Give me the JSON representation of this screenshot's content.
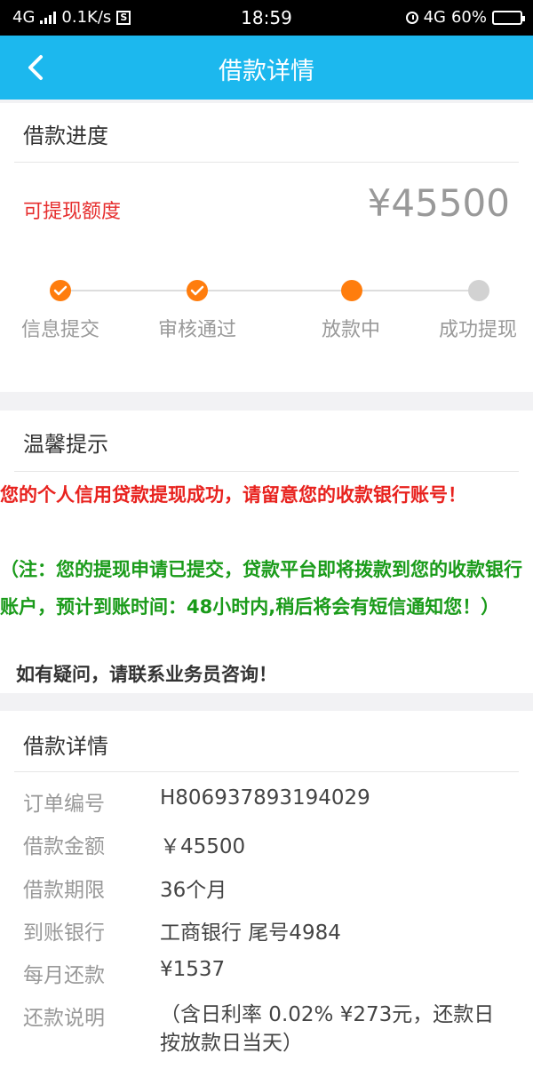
{
  "status_bar": {
    "network": "4G",
    "speed": "0.1K/s",
    "s_badge": "S",
    "time": "18:59",
    "network_right": "4G",
    "battery": "60%"
  },
  "header": {
    "title": "借款详情",
    "back_icon": "chevron-left-icon"
  },
  "progress": {
    "section_title": "借款进度",
    "available_label": "可提现额度",
    "available_amount": "¥45500",
    "steps": [
      {
        "label": "信息提交",
        "state": "done"
      },
      {
        "label": "审核通过",
        "state": "done"
      },
      {
        "label": "放款中",
        "state": "active"
      },
      {
        "label": "成功提现",
        "state": "pending"
      }
    ]
  },
  "notice": {
    "section_title": "温馨提示",
    "red_text": " 您的个人信用贷款提现成功，请留意您的收款银行账号！",
    "green_text": "（注：您的提现申请已提交，贷款平台即将拨款到您的收款银行账户，预计到账时间：48小时内,稍后将会有短信通知您！）",
    "dark_text": "如有疑问，请联系业务员咨询！"
  },
  "details": {
    "section_title": "借款详情",
    "rows": [
      {
        "label": "订单编号",
        "value": "H806937893194029"
      },
      {
        "label": "借款金额",
        "value": "￥45500"
      },
      {
        "label": "借款期限",
        "value": "36个月"
      },
      {
        "label": "到账银行",
        "value": "工商银行 尾号4984"
      },
      {
        "label": "每月还款",
        "value": "¥1537"
      },
      {
        "label": "还款说明",
        "value": "（含日利率 0.02% ¥273元，还款日按放款日当天）"
      }
    ]
  },
  "colors": {
    "nav": "#1cb8ee",
    "accent_orange": "#ff7d0d",
    "red": "#e8221e",
    "green": "#1a9b1a"
  }
}
